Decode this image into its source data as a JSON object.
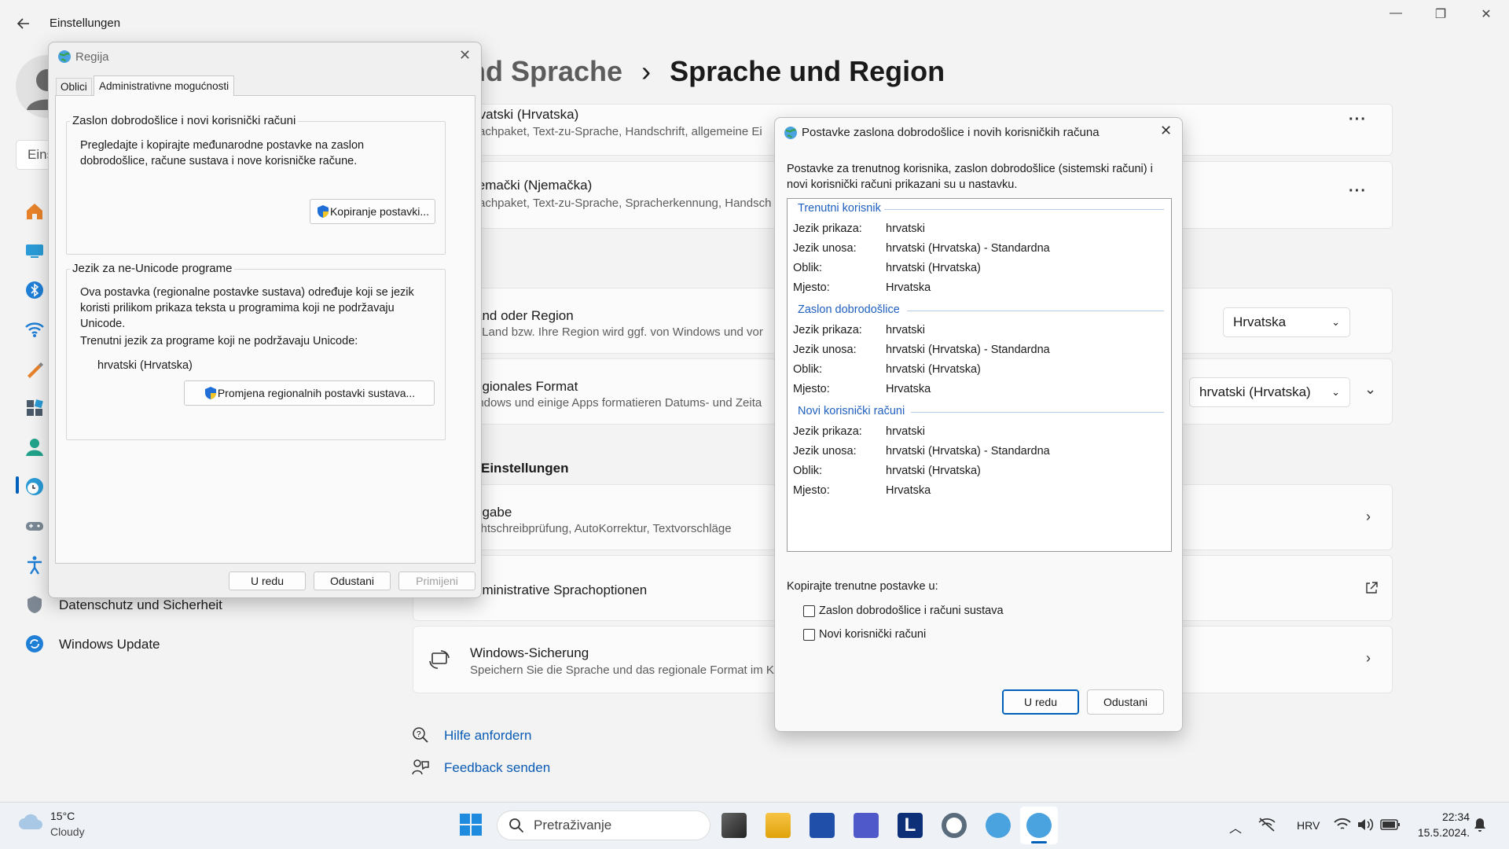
{
  "settings": {
    "title": "Einstellungen",
    "heading_part1": "nd Sprache",
    "heading_sep": "›",
    "heading_part2": "Sprache und Region",
    "search_placeholder": "Eins",
    "languages": [
      {
        "name": "rvatski (Hrvatska)",
        "desc": "rachpaket, Text-zu-Sprache, Handschrift, allgemeine Ei"
      },
      {
        "name": "jemački (Njemačka)",
        "desc": "rachpaket, Text-zu-Sprache, Spracherkennung, Handsch"
      }
    ],
    "region": {
      "name": "and oder Region",
      "desc": "r Land bzw. Ihre Region wird ggf. von Windows und vor",
      "value": "Hrvatska"
    },
    "format": {
      "name": "egionales Format",
      "desc": "indows und einige Apps formatieren Datums- und Zeita",
      "value": "hrvatski (Hrvatska)"
    },
    "related_heading": "Einstellungen",
    "input": {
      "name": "ngabe",
      "desc": "chtschreibprüfung, AutoKorrektur, Textvorschläge"
    },
    "admin": {
      "name": "dministrative Sprachoptionen"
    },
    "backup": {
      "name": "Windows-Sicherung",
      "desc": "Speichern Sie die Sprache und das regionale Format im K"
    },
    "sidebar_items": [
      "Datenschutz und Sicherheit",
      "Windows Update"
    ],
    "links": [
      "Hilfe anfordern",
      "Feedback senden"
    ]
  },
  "regija": {
    "title": "Regija",
    "tabs": [
      "Oblici",
      "Administrativne mogućnosti"
    ],
    "group1": {
      "title": "Zaslon dobrodošlice i novi korisnički računi",
      "text": "Pregledajte i kopirajte međunarodne postavke na zaslon dobrodošlice, račune sustava i nove korisničke račune.",
      "button": "Kopiranje postavki..."
    },
    "group2": {
      "title": "Jezik za ne-Unicode programe",
      "text": "Ova postavka (regionalne postavke sustava) određuje koji se jezik koristi prilikom prikaza teksta u programima koji ne podržavaju Unicode.",
      "current_label": "Trenutni jezik za programe koji ne podržavaju Unicode:",
      "current_value": "hrvatski (Hrvatska)",
      "button": "Promjena regionalnih postavki sustava..."
    },
    "ok": "U redu",
    "cancel": "Odustani",
    "apply": "Primijeni"
  },
  "postavke": {
    "title": "Postavke zaslona dobrodošlice i novih korisničkih računa",
    "intro": "Postavke za trenutnog korisnika, zaslon dobrodošlice (sistemski računi) i novi korisnički računi prikazani su u nastavku.",
    "sections": [
      {
        "title": "Trenutni korisnik",
        "rows": [
          [
            "Jezik prikaza:",
            "hrvatski"
          ],
          [
            "Jezik unosa:",
            "hrvatski (Hrvatska) - Standardna"
          ],
          [
            "Oblik:",
            "hrvatski (Hrvatska)"
          ],
          [
            "Mjesto:",
            "Hrvatska"
          ]
        ]
      },
      {
        "title": "Zaslon dobrodošlice",
        "rows": [
          [
            "Jezik prikaza:",
            "hrvatski"
          ],
          [
            "Jezik unosa:",
            "hrvatski (Hrvatska) - Standardna"
          ],
          [
            "Oblik:",
            "hrvatski (Hrvatska)"
          ],
          [
            "Mjesto:",
            "Hrvatska"
          ]
        ]
      },
      {
        "title": "Novi korisnički računi",
        "rows": [
          [
            "Jezik prikaza:",
            "hrvatski"
          ],
          [
            "Jezik unosa:",
            "hrvatski (Hrvatska) - Standardna"
          ],
          [
            "Oblik:",
            "hrvatski (Hrvatska)"
          ],
          [
            "Mjesto:",
            "Hrvatska"
          ]
        ]
      }
    ],
    "copy_label": "Kopirajte trenutne postavke u:",
    "checkboxes": [
      "Zaslon dobrodošlice i računi sustava",
      "Novi korisnički računi"
    ],
    "ok": "U redu",
    "cancel": "Odustani"
  },
  "taskbar": {
    "weather_temp": "15°C",
    "weather_desc": "Cloudy",
    "search_placeholder": "Pretraživanje",
    "lang": "HRV",
    "time": "22:34",
    "date": "15.5.2024."
  }
}
